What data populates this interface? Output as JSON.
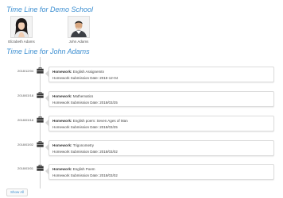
{
  "school_section": {
    "title": "Time Line for Demo School"
  },
  "students": [
    {
      "name": "Elizabeth Adams"
    },
    {
      "name": "John Adams"
    }
  ],
  "timeline_section": {
    "title": "Time Line for John Adams"
  },
  "timeline": [
    {
      "date": "2018/12/04",
      "type_label": "Homework:",
      "subject": "English Assignemtn",
      "submission_label": "Homework Submission Date:",
      "submission_date": "2018-12-04"
    },
    {
      "date": "2018/03/18",
      "type_label": "Homework:",
      "subject": "Mathematics",
      "submission_label": "Homework Submission Date:",
      "submission_date": "2018/03/25"
    },
    {
      "date": "2018/03/18",
      "type_label": "Homework:",
      "subject": "English poem: Seven Ages of Man",
      "submission_label": "Homework Submission Date:",
      "submission_date": "2018/03/25"
    },
    {
      "date": "2018/03/02",
      "type_label": "Homework:",
      "subject": "Trigonometry",
      "submission_label": "Homework Submission Date:",
      "submission_date": "2018/03/02"
    },
    {
      "date": "2018/03/01",
      "type_label": "Homework:",
      "subject": "English Poem",
      "submission_label": "Homework Submission Date:",
      "submission_date": "2018/03/02"
    }
  ],
  "show_all_label": "Show All",
  "colors": {
    "accent": "#3d8fd1",
    "icon": "#3a3a3a",
    "line": "#d0d0d0"
  }
}
